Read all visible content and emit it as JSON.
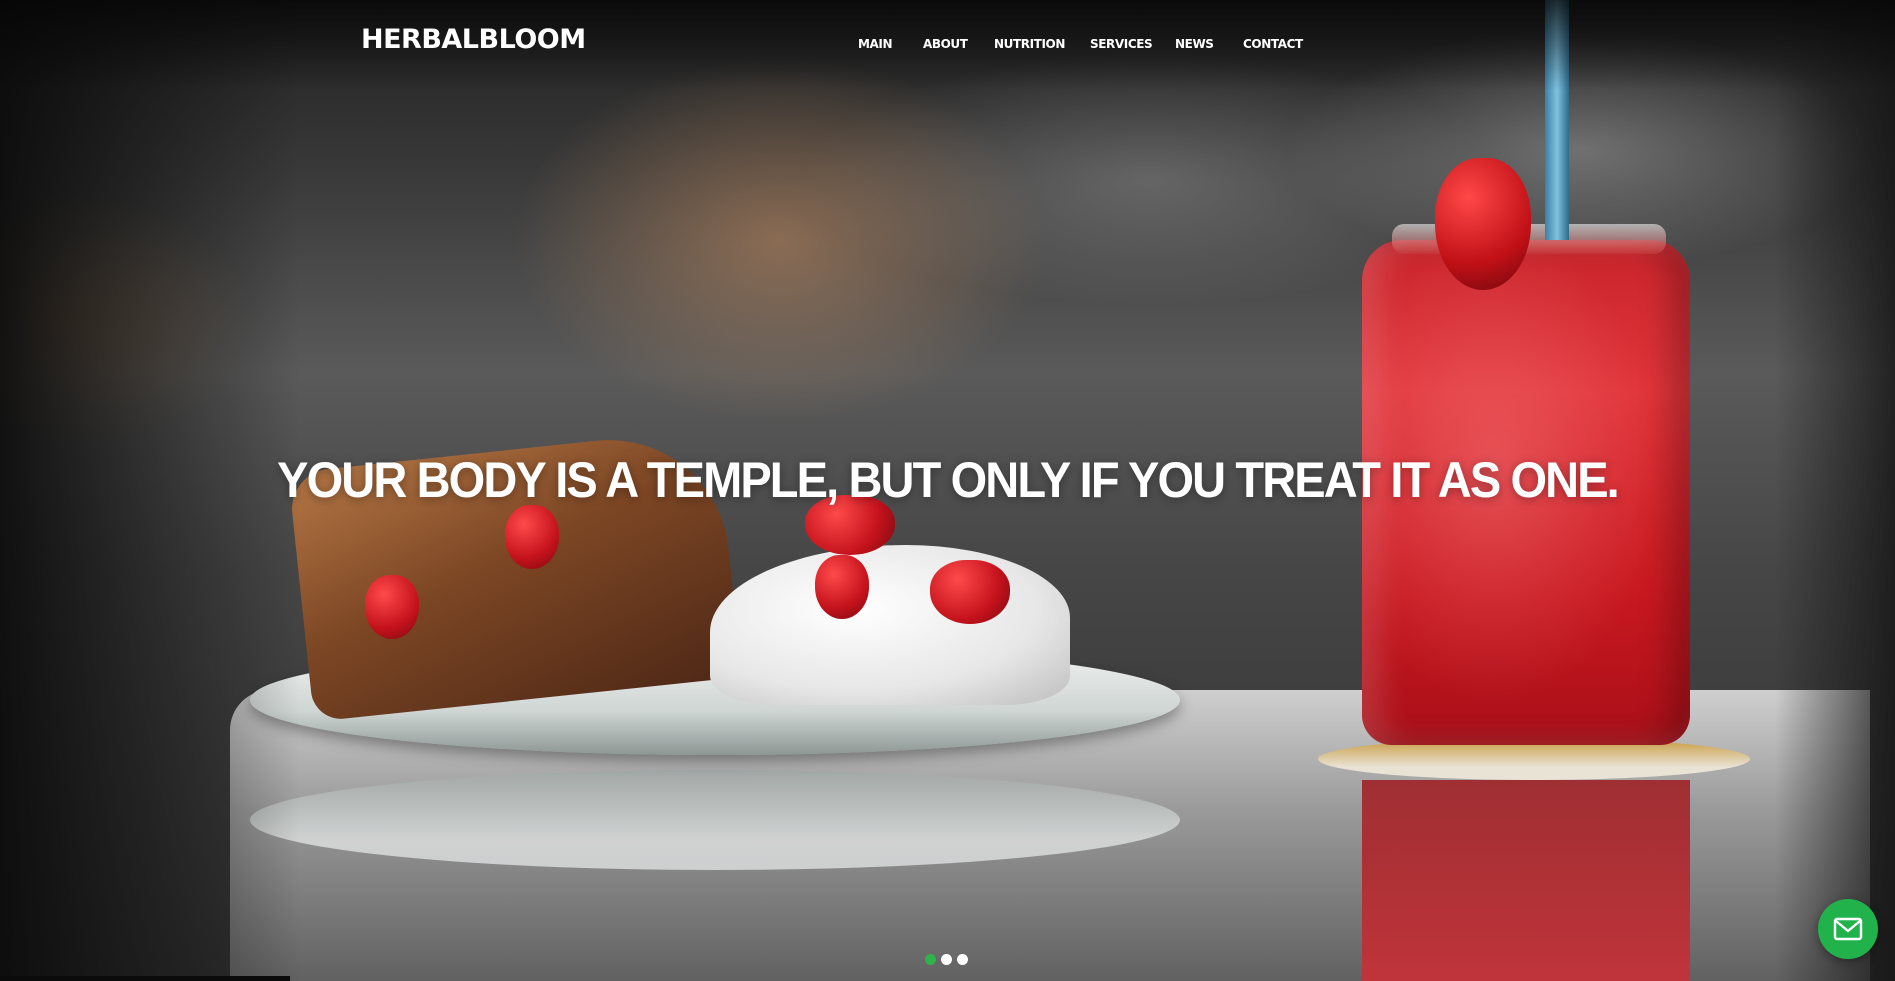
{
  "site": {
    "logo": "HERBALBLOOM"
  },
  "nav": {
    "items": [
      {
        "label": "MAIN"
      },
      {
        "label": "ABOUT"
      },
      {
        "label": "NUTRITION"
      },
      {
        "label": "SERVICES"
      },
      {
        "label": "NEWS"
      },
      {
        "label": "CONTACT"
      }
    ]
  },
  "hero": {
    "headline": "YOUR BODY IS A TEMPLE, BUT ONLY IF YOU TREAT IT AS ONE.",
    "image_description_icon": "waffles-and-strawberry-smoothie-photo"
  },
  "slider": {
    "total": 3,
    "active_index": 0,
    "active_color": "#2fb34a",
    "inactive_color": "#ffffff"
  },
  "contact_fab": {
    "icon": "mail-icon",
    "color": "#22b24c"
  }
}
